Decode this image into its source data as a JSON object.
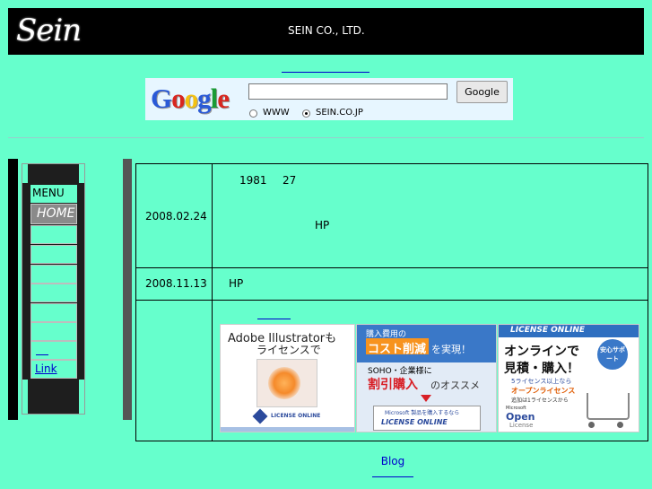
{
  "header": {
    "logo_text": "Sein",
    "company": "SEIN CO., LTD."
  },
  "search": {
    "google_logo": "Google",
    "button_label": "Google",
    "radio_www": "WWW",
    "radio_site": "SEIN.CO.JP",
    "selected": "SEIN.CO.JP"
  },
  "nav": {
    "menu_label": "MENU",
    "home_label": "HOME",
    "link_label": "Link"
  },
  "news": [
    {
      "date": "2008.02.24",
      "text_a": "1981",
      "text_b": "27",
      "text_c": "HP"
    },
    {
      "date": "2008.11.13",
      "text": "HP"
    }
  ],
  "banners": {
    "illustrator": {
      "line1": "Adobe Illustratorも",
      "line2": "ライセンスで",
      "footer": "LICENSE ONLINE"
    },
    "license_mid": {
      "line1": "購入費用の",
      "line2": "コスト削減",
      "line2b": "を実現！",
      "line3": "SOHO・企業様に",
      "line4": "割引購入",
      "line4b": "のオススメ",
      "line5": "Microsoft 製品を購入するなら",
      "footer": "LICENSE ONLINE"
    },
    "license_right": {
      "header": "LICENSE ONLINE",
      "line1": "オンラインで",
      "line2": "見積・購入！",
      "badge": "安心サポート",
      "line3": "5ライセンス以上なら",
      "line4": "オープンライセンス",
      "line5": "追加は1ライセンスから",
      "ms": "Microsoft",
      "open": "Open",
      "license": "License"
    }
  },
  "footer": {
    "blog_label": "Blog"
  },
  "colors": {
    "background": "#66ffcc",
    "header_bg": "#000000",
    "link": "#0000cc"
  }
}
